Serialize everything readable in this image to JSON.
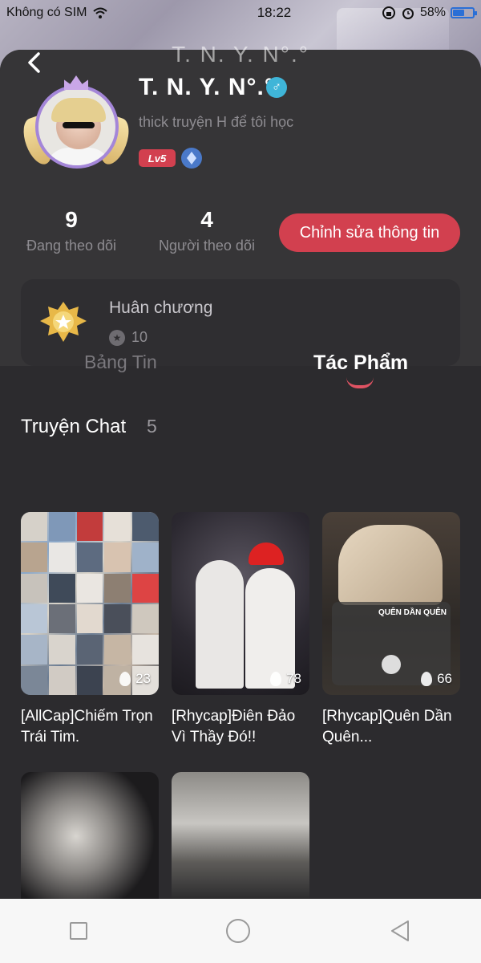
{
  "status_bar": {
    "carrier": "Không có SIM",
    "time": "18:22",
    "battery": "58%",
    "battery_level": 0.58
  },
  "header": {
    "title_ghost": "T. N. Y. N°.°"
  },
  "profile": {
    "name": "T. N. Y. N°.°",
    "gender_symbol": "♂",
    "bio": "thick truyện H để tôi học",
    "level": "Lv5",
    "following_count": "9",
    "following_label": "Đang theo dõi",
    "followers_count": "4",
    "followers_label": "Người theo dõi",
    "edit_label": "Chỉnh sửa thông tin"
  },
  "medals": {
    "title": "Huân chương",
    "count": "10"
  },
  "tabs": [
    {
      "label": "Bảng Tin",
      "active": false
    },
    {
      "label": "Tác Phẩm",
      "active": true
    }
  ],
  "section": {
    "title": "Truyện Chat",
    "count": "5"
  },
  "stories": [
    {
      "title": "[AllCap]Chiếm Trọn Trái Tim.",
      "views": "23"
    },
    {
      "title": "[Rhycap]Điên Đảo Vì Thầy Đó!!",
      "views": "78"
    },
    {
      "title": "[Rhycap]Quên Dần Quên...",
      "views": "66",
      "thumb_text": "QUÊN DẦN QUÊN"
    },
    {
      "title": "",
      "views": ""
    },
    {
      "title": "",
      "views": ""
    }
  ],
  "colors": {
    "accent": "#d2404f",
    "background": "#2c2b2e",
    "card": "#363537"
  },
  "icons": {
    "back": "chevron-left-icon",
    "gender": "male-icon",
    "medal": "medal-icon",
    "views": "fire-icon",
    "nav_recent": "square-icon",
    "nav_home": "circle-icon",
    "nav_back": "triangle-back-icon"
  }
}
